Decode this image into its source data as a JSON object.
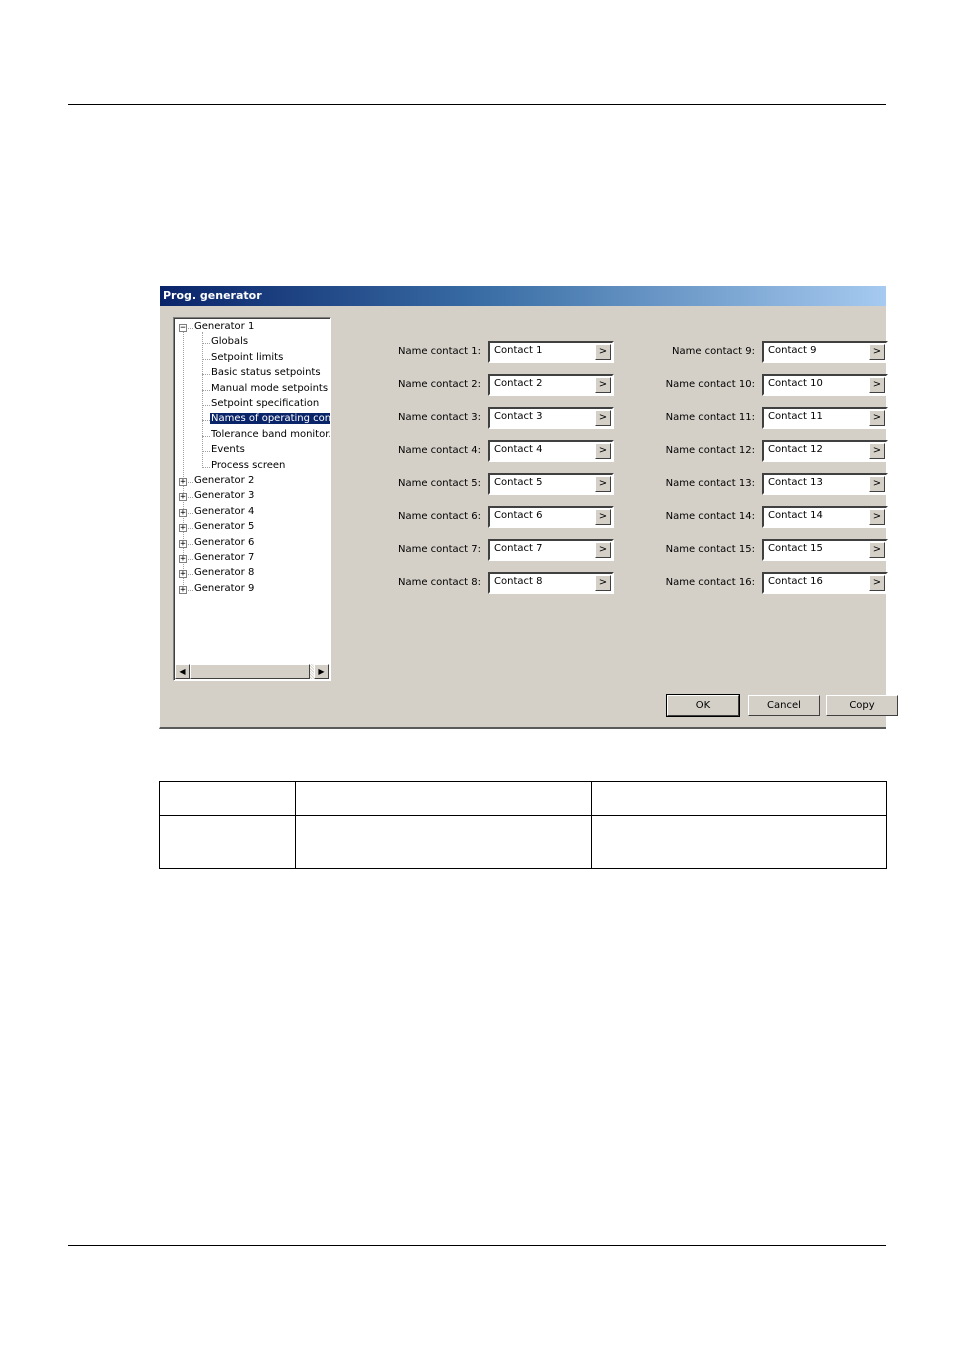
{
  "dialog": {
    "title": "Prog. generator",
    "tree": {
      "items": [
        {
          "label": "Generator 1",
          "level": 0,
          "expanded": true
        },
        {
          "label": "Globals",
          "level": 1
        },
        {
          "label": "Setpoint limits",
          "level": 1
        },
        {
          "label": "Basic status setpoints",
          "level": 1
        },
        {
          "label": "Manual mode setpoints",
          "level": 1
        },
        {
          "label": "Setpoint specification",
          "level": 1
        },
        {
          "label": "Names of operating cont.",
          "level": 1,
          "selected": true
        },
        {
          "label": "Tolerance band monitor.",
          "level": 1
        },
        {
          "label": "Events",
          "level": 1
        },
        {
          "label": "Process screen",
          "level": 1
        },
        {
          "label": "Generator 2",
          "level": 0,
          "expanded": false
        },
        {
          "label": "Generator 3",
          "level": 0,
          "expanded": false
        },
        {
          "label": "Generator 4",
          "level": 0,
          "expanded": false
        },
        {
          "label": "Generator 5",
          "level": 0,
          "expanded": false
        },
        {
          "label": "Generator 6",
          "level": 0,
          "expanded": false
        },
        {
          "label": "Generator 7",
          "level": 0,
          "expanded": false
        },
        {
          "label": "Generator 8",
          "level": 0,
          "expanded": false
        },
        {
          "label": "Generator 9",
          "level": 0,
          "expanded": false
        }
      ],
      "expand_glyph": "+",
      "collapse_glyph": "−",
      "scroll_left_glyph": "◀",
      "scroll_right_glyph": "▶"
    },
    "contacts_left": [
      {
        "label": "Name contact 1:",
        "value": "Contact 1"
      },
      {
        "label": "Name contact 2:",
        "value": "Contact 2"
      },
      {
        "label": "Name contact 3:",
        "value": "Contact 3"
      },
      {
        "label": "Name contact 4:",
        "value": "Contact 4"
      },
      {
        "label": "Name contact 5:",
        "value": "Contact 5"
      },
      {
        "label": "Name contact 6:",
        "value": "Contact 6"
      },
      {
        "label": "Name contact 7:",
        "value": "Contact 7"
      },
      {
        "label": "Name contact 8:",
        "value": "Contact 8"
      }
    ],
    "contacts_right": [
      {
        "label": "Name contact 9:",
        "value": "Contact 9"
      },
      {
        "label": "Name contact 10:",
        "value": "Contact 10"
      },
      {
        "label": "Name contact 11:",
        "value": "Contact 11"
      },
      {
        "label": "Name contact 12:",
        "value": "Contact 12"
      },
      {
        "label": "Name contact 13:",
        "value": "Contact 13"
      },
      {
        "label": "Name contact 14:",
        "value": "Contact 14"
      },
      {
        "label": "Name contact 15:",
        "value": "Contact 15"
      },
      {
        "label": "Name contact 16:",
        "value": "Contact 16"
      }
    ],
    "field_button_glyph": ">",
    "buttons": {
      "ok": "OK",
      "cancel": "Cancel",
      "copy": "Copy"
    }
  },
  "document_table": {
    "rows": [
      [
        "",
        "",
        ""
      ],
      [
        "",
        "",
        ""
      ]
    ]
  }
}
